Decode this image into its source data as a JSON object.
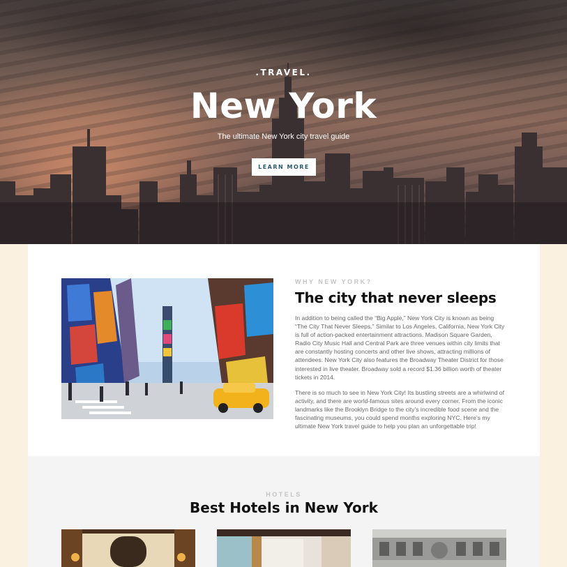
{
  "hero": {
    "kicker": ".TRAVEL.",
    "title": "New York",
    "subtitle": "The ultimate New York city travel guide",
    "cta_label": "LEARN MORE"
  },
  "why": {
    "eyebrow": "WHY NEW YORK?",
    "title": "The city that never sleeps",
    "paragraphs": [
      "In addition to being called the “Big Apple,” New York City is known as being “The City That Never Sleeps.” Similar to Los Angeles, California, New York City is full of action-packed entertainment attractions. Madison Square Garden, Radio City Music Hall and Central Park are three venues within city limits that are constantly hosting concerts and other live shows, attracting millions of attendees. New York City also features the Broadway Theater District for those interested in live theater. Broadway sold a record $1.36 billion worth of theater tickets in 2014.",
      "There is so much to see in New York City! Its bustling streets are a whirlwind of activity, and there are world-famous sites around every corner. From the iconic landmarks like the Brooklyn Bridge to the city’s incredible food scene and the fascinating museums, you could spend months exploring NYC. Here’s my ultimate New York travel guide to help you plan an unforgettable trip!"
    ]
  },
  "hotels": {
    "eyebrow": "HOTELS",
    "title": "Best Hotels in New York"
  },
  "colors": {
    "cta_text": "#2a5970",
    "eyebrow": "#c4c4c4",
    "body_text": "#666666",
    "taxi": "#f2b21c"
  }
}
